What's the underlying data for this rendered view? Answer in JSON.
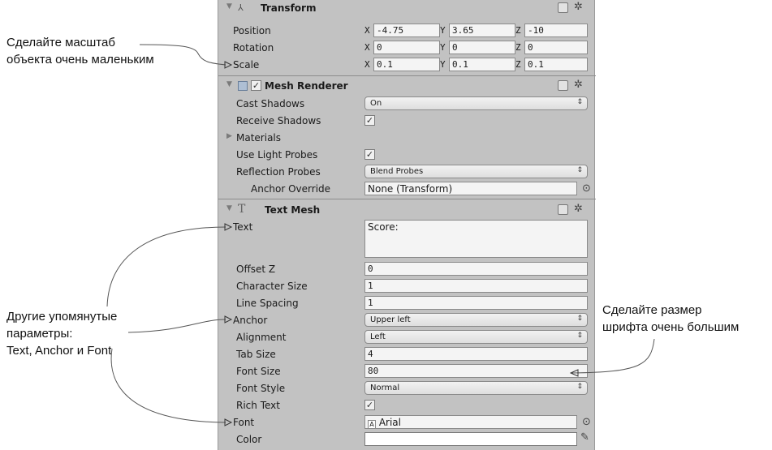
{
  "transform": {
    "title": "Transform",
    "rows": [
      {
        "label": "Position",
        "x": "-4.75",
        "y": "3.65",
        "z": "-10"
      },
      {
        "label": "Rotation",
        "x": "0",
        "y": "0",
        "z": "0"
      },
      {
        "label": "Scale",
        "x": "0.1",
        "y": "0.1",
        "z": "0.1"
      }
    ],
    "axis": {
      "x": "X",
      "y": "Y",
      "z": "Z"
    }
  },
  "mesh_renderer": {
    "title": "Mesh Renderer",
    "cast_shadows_label": "Cast Shadows",
    "cast_shadows_value": "On",
    "receive_shadows_label": "Receive Shadows",
    "materials_label": "Materials",
    "use_light_probes_label": "Use Light Probes",
    "reflection_probes_label": "Reflection Probes",
    "reflection_probes_value": "Blend Probes",
    "anchor_override_label": "Anchor Override",
    "anchor_override_value": "None (Transform)"
  },
  "text_mesh": {
    "title": "Text Mesh",
    "text_label": "Text",
    "text_value": "Score:",
    "offset_z_label": "Offset Z",
    "offset_z_value": "0",
    "character_size_label": "Character Size",
    "character_size_value": "1",
    "line_spacing_label": "Line Spacing",
    "line_spacing_value": "1",
    "anchor_label": "Anchor",
    "anchor_value": "Upper left",
    "alignment_label": "Alignment",
    "alignment_value": "Left",
    "tab_size_label": "Tab Size",
    "tab_size_value": "4",
    "font_size_label": "Font Size",
    "font_size_value": "80",
    "font_style_label": "Font Style",
    "font_style_value": "Normal",
    "rich_text_label": "Rich Text",
    "font_label": "Font",
    "font_value": "Arial",
    "color_label": "Color",
    "color_value": "#ffffff"
  },
  "annotations": {
    "scale_line1": "Сделайте масштаб",
    "scale_line2": "объекта очень маленьким",
    "params_line1": "Другие упомянутые",
    "params_line2": "параметры:",
    "params_line3": "Text, Anchor и Font",
    "font_line1": "Сделайте размер",
    "font_line2": "шрифта очень большим"
  },
  "glyphs": {
    "fold_open": "▼",
    "fold_closed": "▶",
    "check": "✓",
    "gear": "✲",
    "dropdown_arrow": "⇕",
    "object_picker": "⊙"
  }
}
